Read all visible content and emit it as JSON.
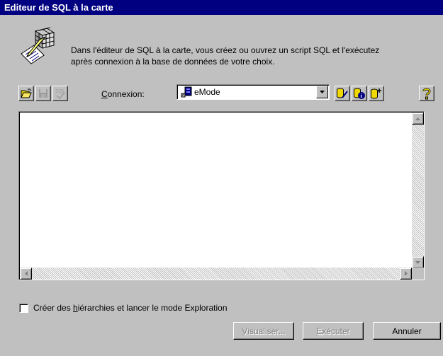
{
  "window": {
    "title": "Editeur de SQL à la carte"
  },
  "intro": {
    "line1": "Dans l'éditeur de SQL à la carte, vous créez ou ouvrez un script SQL et l'exécutez",
    "line2": "après connexion à la base de données de votre choix.",
    "icon": "sql-editor-illustration-icon"
  },
  "toolbar": {
    "buttons": [
      {
        "icon": "open-folder-icon",
        "enabled": true
      },
      {
        "icon": "save-disk-icon",
        "enabled": false
      },
      {
        "icon": "sql-check-icon",
        "enabled": false
      }
    ],
    "connection_label_accel": "C",
    "connection_label_rest": "onnexion:",
    "connection_value": "eMode",
    "connection_icon": "database-connection-icon",
    "right_buttons": [
      {
        "icon": "database-edit-icon"
      },
      {
        "icon": "database-info-icon"
      },
      {
        "icon": "database-add-icon"
      },
      {
        "icon": "help-icon"
      }
    ]
  },
  "editor": {
    "content": ""
  },
  "options": {
    "checkbox_prefix": "Créer des ",
    "checkbox_accel": "h",
    "checkbox_rest": "iérarchies et lancer le mode Exploration",
    "checked": false
  },
  "buttons": {
    "preview_accel": "V",
    "preview_rest": "isualiser...",
    "execute_accel": "E",
    "execute_rest": "xécuter",
    "cancel": "Annuler"
  },
  "colors": {
    "titlebar": "#000080",
    "face": "#c0c0c0",
    "db_yellow": "#f0d800"
  }
}
